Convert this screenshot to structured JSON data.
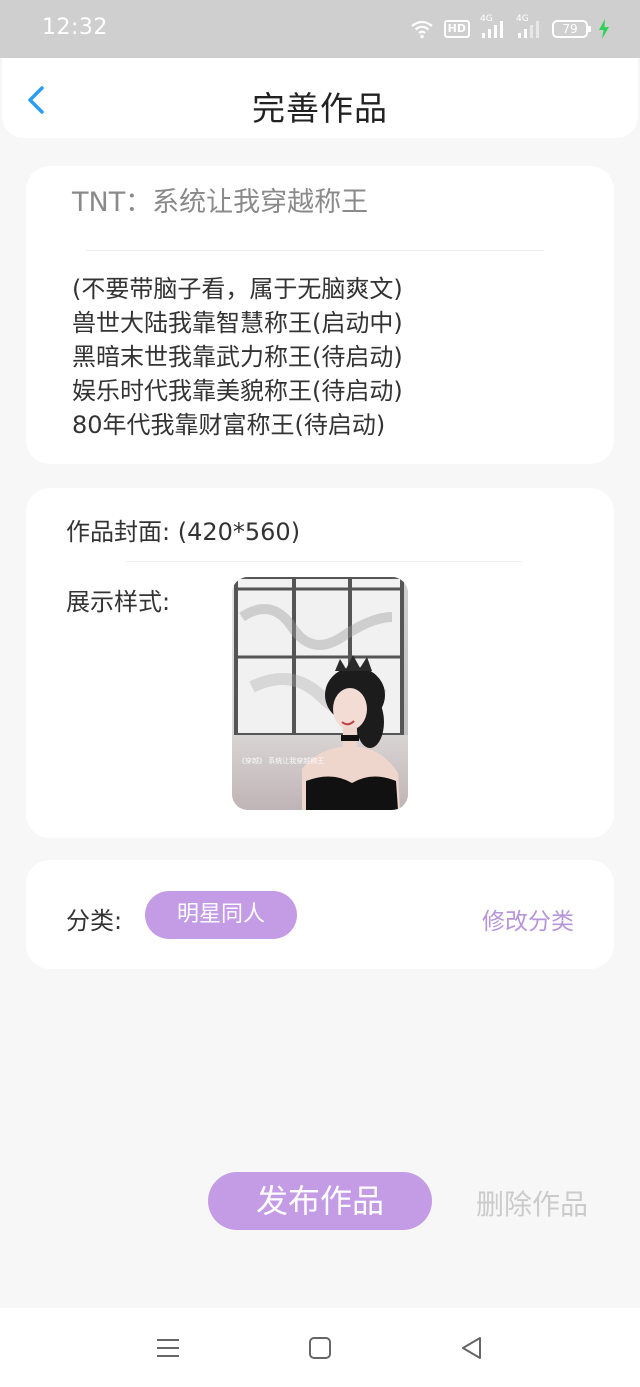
{
  "status_bar": {
    "time": "12:32",
    "hd_label": "HD",
    "signal_label": "4G",
    "battery": "79",
    "icons": [
      "wifi-icon",
      "hd-icon",
      "signal-4g-icon",
      "signal-4g-icon",
      "battery-icon",
      "charging-icon"
    ]
  },
  "header": {
    "title": "完善作品",
    "back_icon": "chevron-left-icon"
  },
  "work": {
    "title": "TNT：系统让我穿越称王",
    "description_lines": [
      "(不要带脑子看，属于无脑爽文)",
      "兽世大陆我靠智慧称王(启动中)",
      "黑暗末世我靠武力称王(待启动)",
      "娱乐时代我靠美貌称王(待启动)",
      "80年代我靠财富称王(待启动)"
    ]
  },
  "cover": {
    "label": "作品封面: (420*560)",
    "style_label": "展示样式:",
    "image_overlay_text": "《穿越》 系统让我穿越称王"
  },
  "category": {
    "label": "分类:",
    "value": "明星同人",
    "edit_label": "修改分类"
  },
  "actions": {
    "publish": "发布作品",
    "delete": "删除作品"
  },
  "nav": {
    "icons": [
      "menu-icon",
      "home-icon",
      "back-triangle-icon"
    ]
  },
  "colors": {
    "accent": "#c49ce6",
    "accent_text": "#b795db",
    "back_arrow": "#2a9df4",
    "status_bar": "#cfcfcf",
    "background": "#f7f7f7"
  }
}
